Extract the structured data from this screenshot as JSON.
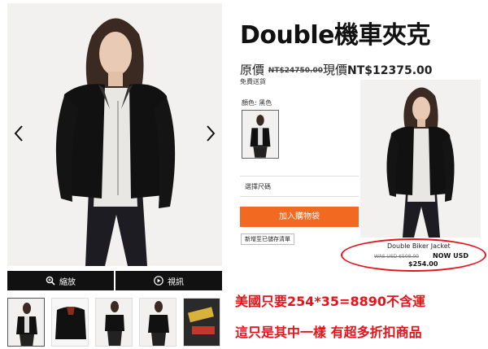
{
  "product": {
    "title": "Double機車夾克",
    "original_label": "原價",
    "original_price": "NT$24750.00",
    "current_label": "現價",
    "current_price": "NT$12375.00",
    "shipping": "免費送貨",
    "color_label": "顏色: 黑色",
    "size_placeholder": "選擇尺碼",
    "add_to_bag": "加入購物袋",
    "wishlist": "新增至已儲存清單"
  },
  "media": {
    "zoom_label": "縮放",
    "video_label": "視訊"
  },
  "us_listing": {
    "name": "Double Biker Jacket",
    "was": "WAS USD $508.00",
    "now_label": "NOW USD",
    "now_price": "$254.00"
  },
  "annotations": {
    "line1": "美國只要254*35=8890不含運",
    "line2": "這只是其中一樣 有超多折扣商品"
  },
  "colors": {
    "accent_orange": "#f26a21",
    "annotation_red": "#e8121a",
    "media_bar": "#111111"
  }
}
